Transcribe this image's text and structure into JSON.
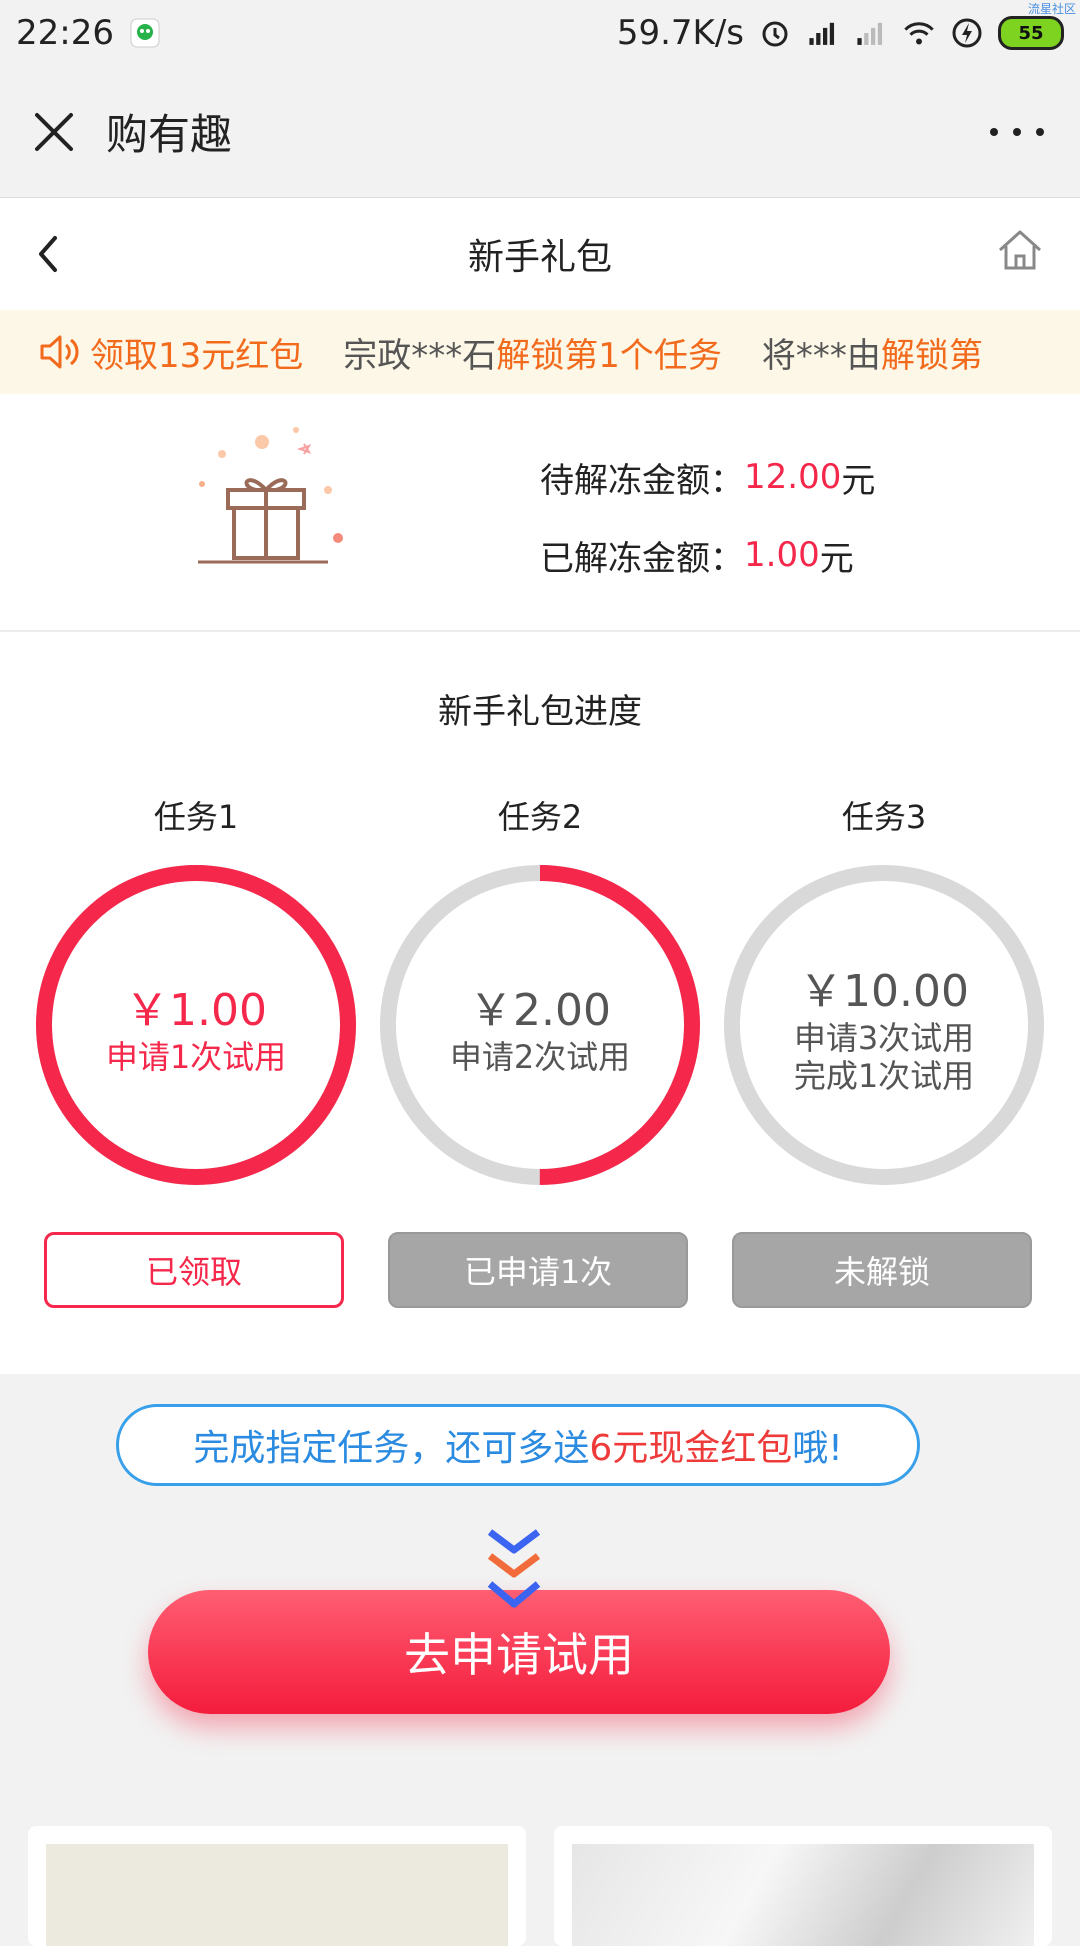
{
  "status": {
    "time": "22:26",
    "speed": "59.7K/s",
    "battery": "55",
    "watermark": "流星社区"
  },
  "wechat": {
    "title": "购有趣"
  },
  "page": {
    "title": "新手礼包"
  },
  "notice": {
    "items": [
      {
        "prefix": "",
        "highlight": "领取13元红包"
      },
      {
        "prefix": "宗政***石",
        "highlight": "解锁第1个任务"
      },
      {
        "prefix": "将***由",
        "highlight": "解锁第"
      }
    ]
  },
  "summary": {
    "pending_label": "待解冻金额：",
    "pending_value": "12.00",
    "unfrozen_label": "已解冻金额：",
    "unfrozen_value": "1.00",
    "unit": "元"
  },
  "progress": {
    "title": "新手礼包进度",
    "tasks": [
      {
        "label": "任务1",
        "amount": "￥1.00",
        "desc1": "申请1次试用",
        "desc2": "",
        "button": "已领取",
        "progress": 1.0
      },
      {
        "label": "任务2",
        "amount": "￥2.00",
        "desc1": "申请2次试用",
        "desc2": "",
        "button": "已申请1次",
        "progress": 0.5
      },
      {
        "label": "任务3",
        "amount": "￥10.00",
        "desc1": "申请3次试用",
        "desc2": "完成1次试用",
        "button": "未解锁",
        "progress": 0.0
      }
    ]
  },
  "promo": {
    "text_prefix": "完成指定任务，还可多送",
    "text_highlight": "6元现金红包",
    "text_suffix": "哦!"
  },
  "cta": {
    "label": "去申请试用"
  },
  "colors": {
    "accent": "#f5284b",
    "notice_highlight": "#f26b1d",
    "promo_blue": "#2b8be0",
    "ring_track": "#d9d9d9"
  }
}
